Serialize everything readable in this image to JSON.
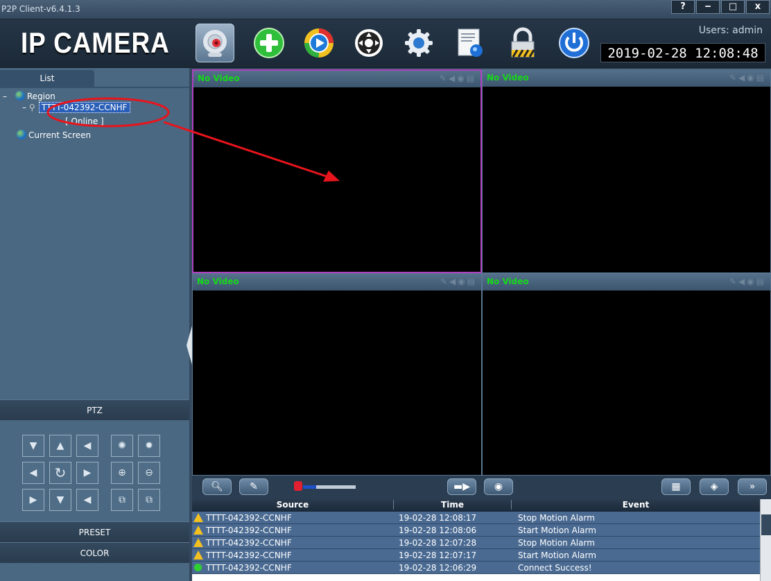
{
  "window": {
    "title": "P2P Client-v6.4.1.3",
    "buttons": {
      "help": "?",
      "minimize": "‒",
      "maximize": "□",
      "close": "x"
    }
  },
  "header": {
    "logo": "IP CAMERA",
    "users": "Users: admin",
    "datetime": "2019-02-28 12:08:48",
    "toolbar": [
      "camera-icon",
      "add-icon",
      "playback-icon",
      "ptz-wheel-icon",
      "settings-icon",
      "log-icon",
      "lock-icon",
      "power-icon"
    ]
  },
  "left": {
    "list_tab": "List",
    "tree": {
      "region_toggle": "–",
      "region": "Region",
      "device_toggle": "–",
      "device": "TTTT-042392-CCNHF",
      "device_status": "[ Online ]",
      "current_screen": "Current Screen"
    },
    "ptz": "PTZ",
    "preset": "PRESET",
    "color": "COLOR"
  },
  "video": {
    "panes": [
      {
        "label": "No Video"
      },
      {
        "label": "No Video"
      },
      {
        "label": "No Video"
      },
      {
        "label": "No Video"
      }
    ]
  },
  "volume": {
    "level": 0.25
  },
  "events": {
    "columns": [
      "Source",
      "Time",
      "Event"
    ],
    "rows": [
      {
        "icon": "warning-icon",
        "source": "TTTT-042392-CCNHF",
        "time": "19-02-28 12:08:17",
        "event": "Stop Motion Alarm"
      },
      {
        "icon": "warning-icon",
        "source": "TTTT-042392-CCNHF",
        "time": "19-02-28 12:08:06",
        "event": "Start Motion Alarm"
      },
      {
        "icon": "warning-icon",
        "source": "TTTT-042392-CCNHF",
        "time": "19-02-28 12:07:28",
        "event": "Stop Motion Alarm"
      },
      {
        "icon": "warning-icon",
        "source": "TTTT-042392-CCNHF",
        "time": "19-02-28 12:07:17",
        "event": "Start Motion Alarm"
      },
      {
        "icon": "connected-icon",
        "source": "TTTT-042392-CCNHF",
        "time": "19-02-28 12:06:29",
        "event": "Connect Success!"
      }
    ]
  },
  "colors": {
    "annotation": "#e8141c",
    "selected_pane": "#b040c0",
    "no_video_text": "#17d81a"
  }
}
